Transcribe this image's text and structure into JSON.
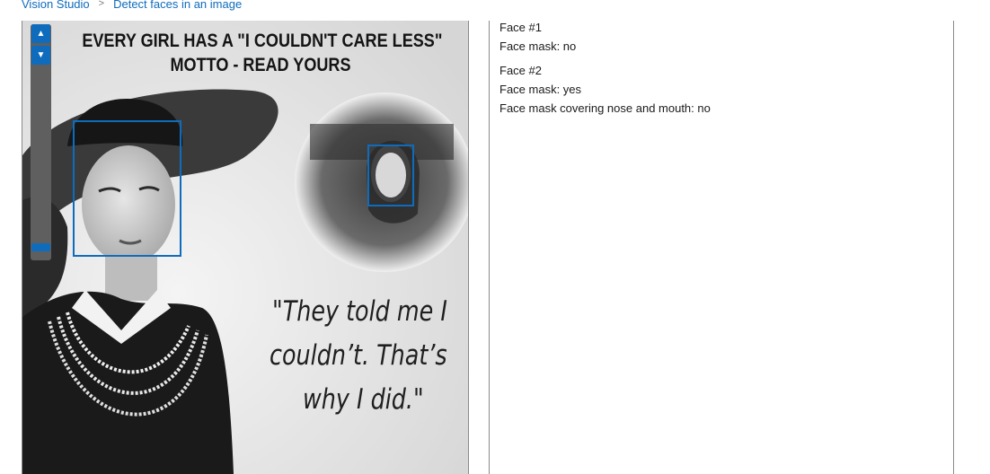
{
  "breadcrumb": {
    "items": [
      "Vision Studio",
      "Detect faces in an image"
    ],
    "separator": ">"
  },
  "image_viewer": {
    "zoom_in_icon": "chevron-up-icon",
    "zoom_out_icon": "chevron-down-icon",
    "poster": {
      "title_line1": "EVERY GIRL HAS A \"I COULDN'T CARE LESS\"",
      "title_line2": "MOTTO - READ YOURS",
      "quote_line1": "\"They told me I",
      "quote_line2": "couldn’t. That’s",
      "quote_line3": "why I did.\""
    }
  },
  "results": {
    "faces": [
      {
        "label": "Face #1",
        "mask": "Face mask: no"
      },
      {
        "label": "Face #2",
        "mask": "Face mask: yes",
        "covering": "Face mask covering nose and mouth: no"
      }
    ]
  },
  "colors": {
    "accent": "#0f6cbd",
    "panel_border": "#8a8a8a",
    "zoom_track": "#5f5f5f"
  }
}
